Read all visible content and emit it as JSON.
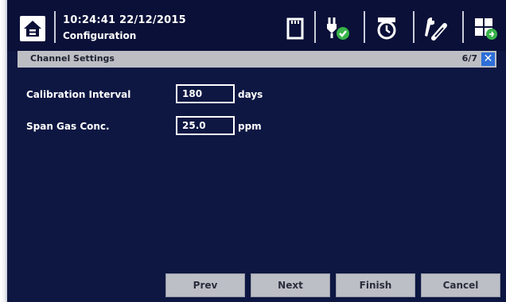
{
  "header": {
    "datetime": "10:24:41  22/12/2015",
    "screen_name": "Configuration",
    "icons": [
      "home-icon",
      "sd-card-icon",
      "power-plug-ok-icon",
      "clock-alarm-icon",
      "tools-icon",
      "grid-status-icon"
    ]
  },
  "titlebar": {
    "title": "Channel Settings",
    "page": "6/7",
    "close_label": "✕"
  },
  "fields": [
    {
      "label": "Calibration Interval",
      "value": "180",
      "unit": "days"
    },
    {
      "label": "Span Gas Conc.",
      "value": "25.0",
      "unit": "ppm"
    }
  ],
  "footer": {
    "prev": "Prev",
    "next": "Next",
    "finish": "Finish",
    "cancel": "Cancel"
  },
  "colors": {
    "background": "#0d1742",
    "header": "#0a1038",
    "titlebar": "#bcbec4",
    "close": "#2d6ed8",
    "ok_green": "#38b34a"
  }
}
